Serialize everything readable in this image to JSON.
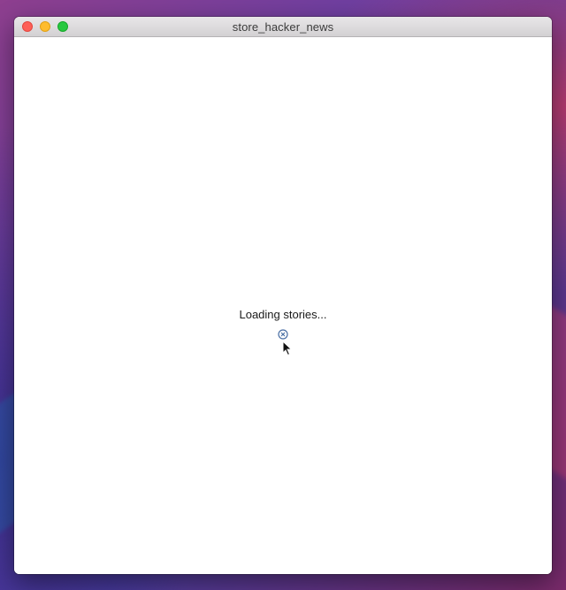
{
  "window": {
    "title": "store_hacker_news"
  },
  "content": {
    "loading_text": "Loading stories..."
  },
  "icons": {
    "spinner": "circle-x-icon",
    "cursor": "arrow-cursor-icon"
  },
  "colors": {
    "close": "#fe5f57",
    "minimize": "#febc2e",
    "maximize": "#28c840"
  }
}
